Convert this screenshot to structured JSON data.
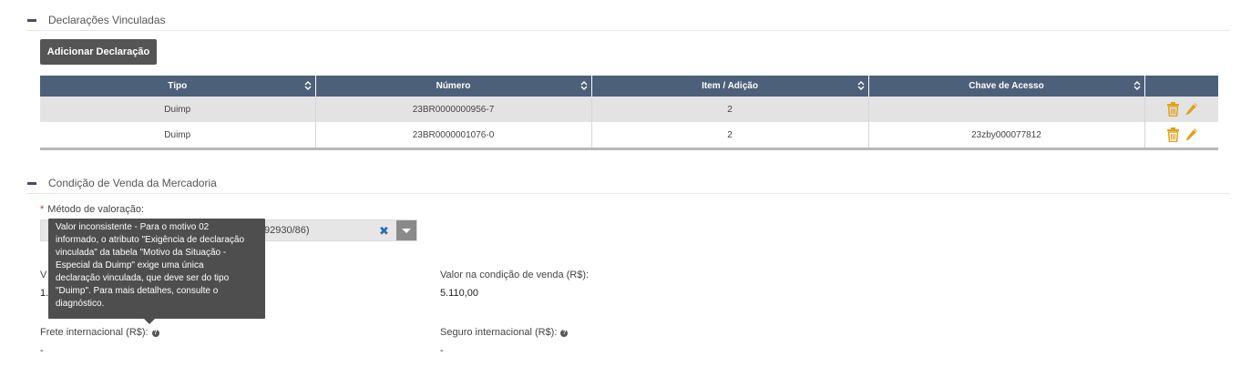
{
  "section_declaracoes": {
    "title": "Declarações Vinculadas",
    "add_button": "Adicionar Declaração",
    "table": {
      "headers": [
        "Tipo",
        "Número",
        "Item / Adição",
        "Chave de Acesso"
      ],
      "rows": [
        {
          "tipo": "Duimp",
          "numero": "23BR0000000956-7",
          "item": "2",
          "chave": ""
        },
        {
          "tipo": "Duimp",
          "numero": "23BR0000001076-0",
          "item": "2",
          "chave": "23zby000077812"
        }
      ]
    }
  },
  "section_condicao": {
    "title": "Condição de Venda da Mercadoria",
    "metodo_label": "Método de valoração:",
    "metodo_value_partial": "92930/86)",
    "field_left_label_partial": "V",
    "field_left_value_partial": "1.",
    "valor_venda_label": "Valor na condição de venda (R$):",
    "valor_venda_value": "5.110,00",
    "frete_label": "Frete internacional (R$):",
    "frete_value": "-",
    "seguro_label": "Seguro internacional (R$):",
    "seguro_value": "-"
  },
  "tooltip": {
    "lines": [
      "Valor inconsistente - Para o motivo 02",
      "informado, o atributo \"Exigência de declaração",
      "vinculada\" da tabela \"Motivo da Situação -",
      "Especial da Duimp\" exige uma única",
      "declaração vinculada, que deve ser do tipo",
      "\"Duimp\". Para mais detalhes, consulte o",
      "diagnóstico."
    ]
  },
  "icons": {
    "collapse": "minus-icon",
    "sort": "sort-icon",
    "delete": "trash-icon",
    "edit": "pencil-icon",
    "clear": "clear-x-icon",
    "dropdown": "chevron-down-icon",
    "help": "help-icon"
  },
  "colors": {
    "header_bg": "#4d607a",
    "button_bg": "#555555",
    "action_icon": "#e0a21b",
    "tooltip_bg": "#4e4e4e",
    "required": "#c0392b",
    "clear_x": "#2a6fb5"
  }
}
